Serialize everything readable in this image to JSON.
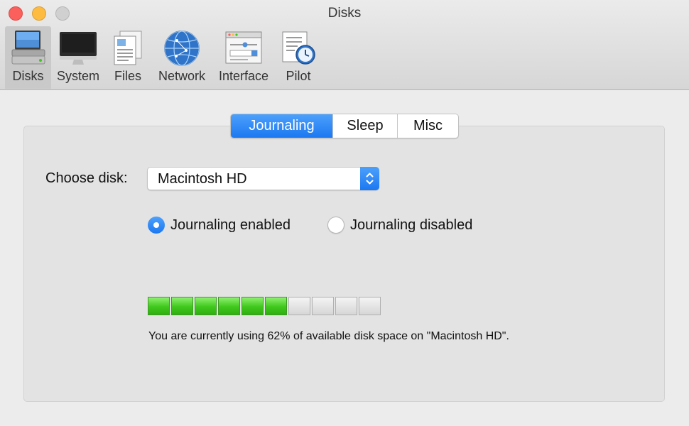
{
  "window": {
    "title": "Disks"
  },
  "toolbar": {
    "items": [
      {
        "label": "Disks",
        "icon": "disks-icon",
        "active": true
      },
      {
        "label": "System",
        "icon": "monitor-icon"
      },
      {
        "label": "Files",
        "icon": "files-icon"
      },
      {
        "label": "Network",
        "icon": "globe-icon"
      },
      {
        "label": "Interface",
        "icon": "interface-icon"
      },
      {
        "label": "Pilot",
        "icon": "clock-document-icon"
      }
    ]
  },
  "tabs": [
    {
      "label": "Journaling",
      "selected": true
    },
    {
      "label": "Sleep"
    },
    {
      "label": "Misc"
    }
  ],
  "choose_disk": {
    "label": "Choose disk:",
    "selected": "Macintosh HD"
  },
  "journaling": {
    "enabled_label": "Journaling enabled",
    "disabled_label": "Journaling disabled",
    "value": "enabled"
  },
  "usage": {
    "percent": 62,
    "segments_total": 10,
    "segments_filled": 6,
    "status_text": "You are currently using 62% of available disk space on \"Macintosh HD\"."
  },
  "colors": {
    "accent": "#1b78f1",
    "meter_fill": "#3fc81c",
    "close": "#fc605c",
    "minimize": "#fdbc40"
  }
}
